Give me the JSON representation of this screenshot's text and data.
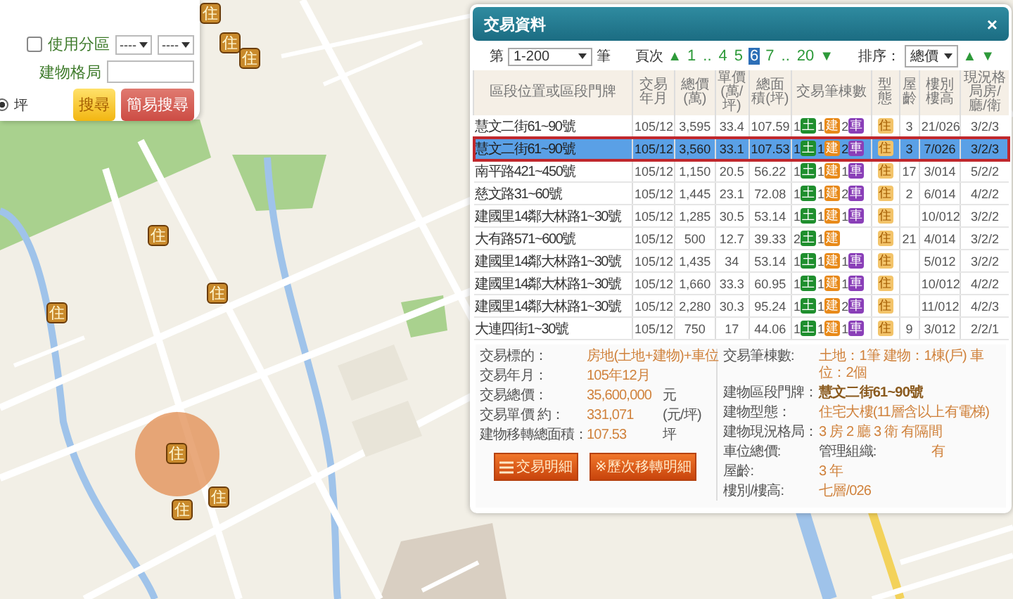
{
  "search_panel": {
    "zone_checkbox": {
      "label": "使用分區",
      "checked": false
    },
    "zone_selects": [
      "----",
      "----"
    ],
    "layout_label": "建物格局",
    "unit_radio": {
      "label": "坪",
      "selected": true
    },
    "buttons": [
      "搜尋",
      "簡易搜尋"
    ]
  },
  "map_markers": [
    {
      "label": "住",
      "selected": false
    },
    {
      "label": "住",
      "selected": false
    },
    {
      "label": "住",
      "selected": false
    },
    {
      "label": "住",
      "selected": false
    },
    {
      "label": "住",
      "selected": false
    },
    {
      "label": "住",
      "selected": false
    },
    {
      "label": "住",
      "selected": true
    },
    {
      "label": "住",
      "selected": false
    },
    {
      "label": "住",
      "selected": false
    }
  ],
  "dialog": {
    "title": "交易資料",
    "close": "×",
    "range": {
      "prefix": "第",
      "value": "1-200",
      "suffix": "筆"
    },
    "pager": {
      "label": "頁次",
      "prev": "▲",
      "next": "▼",
      "pages": [
        {
          "label": "1",
          "selected": false
        },
        {
          "label": "..",
          "selected": false
        },
        {
          "label": "4",
          "selected": false
        },
        {
          "label": "5",
          "selected": false
        },
        {
          "label": "6",
          "selected": true
        },
        {
          "label": "7",
          "selected": false
        },
        {
          "label": "..",
          "selected": false
        },
        {
          "label": "20",
          "selected": false
        }
      ]
    },
    "sort": {
      "label": "排序：",
      "value": "總價",
      "asc": "▲",
      "desc": "▼"
    },
    "table": {
      "columns": [
        "區段位置或區段門牌",
        "交易年月",
        "總價(萬)",
        "單價(萬/坪)",
        "總面積(坪)",
        "交易筆棟數",
        "型態",
        "屋齡",
        "樓別樓高",
        "現況格局房/廳/衛"
      ],
      "rows": [
        {
          "address": "慧文二街61~90號",
          "date": "105/12",
          "total": "3,595",
          "unit": "33.4",
          "area": "107.59",
          "tags": [
            {
              "kind": "land",
              "count": "1",
              "label": "土"
            },
            {
              "kind": "building",
              "count": "1",
              "label": "建"
            },
            {
              "kind": "parking",
              "count": "2",
              "label": "車"
            }
          ],
          "type": "住",
          "age": "3",
          "floor": "21/026",
          "layout": "3/2/3",
          "selected": false
        },
        {
          "address": "慧文二街61~90號",
          "date": "105/12",
          "total": "3,560",
          "unit": "33.1",
          "area": "107.53",
          "tags": [
            {
              "kind": "land",
              "count": "1",
              "label": "土"
            },
            {
              "kind": "building",
              "count": "1",
              "label": "建"
            },
            {
              "kind": "parking",
              "count": "2",
              "label": "車"
            }
          ],
          "type": "住",
          "age": "3",
          "floor": "7/026",
          "layout": "3/2/3",
          "selected": true
        },
        {
          "address": "南平路421~450號",
          "date": "105/12",
          "total": "1,150",
          "unit": "20.5",
          "area": "56.22",
          "tags": [
            {
              "kind": "land",
              "count": "1",
              "label": "土"
            },
            {
              "kind": "building",
              "count": "1",
              "label": "建"
            },
            {
              "kind": "parking",
              "count": "1",
              "label": "車"
            }
          ],
          "type": "住",
          "age": "17",
          "floor": "3/014",
          "layout": "5/2/2",
          "selected": false
        },
        {
          "address": "慈文路31~60號",
          "date": "105/12",
          "total": "1,445",
          "unit": "23.1",
          "area": "72.08",
          "tags": [
            {
              "kind": "land",
              "count": "1",
              "label": "土"
            },
            {
              "kind": "building",
              "count": "1",
              "label": "建"
            },
            {
              "kind": "parking",
              "count": "2",
              "label": "車"
            }
          ],
          "type": "住",
          "age": "2",
          "floor": "6/014",
          "layout": "4/2/2",
          "selected": false
        },
        {
          "address": "建國里14鄰大林路1~30號",
          "date": "105/12",
          "total": "1,285",
          "unit": "30.5",
          "area": "53.14",
          "tags": [
            {
              "kind": "land",
              "count": "1",
              "label": "土"
            },
            {
              "kind": "building",
              "count": "1",
              "label": "建"
            },
            {
              "kind": "parking",
              "count": "1",
              "label": "車"
            }
          ],
          "type": "住",
          "floor": "10/012",
          "layout": "3/2/2",
          "selected": false
        },
        {
          "address": "大有路571~600號",
          "date": "105/12",
          "total": "500",
          "unit": "12.7",
          "area": "39.33",
          "tags": [
            {
              "kind": "land",
              "count": "2",
              "label": "土"
            },
            {
              "kind": "building",
              "count": "1",
              "label": "建"
            }
          ],
          "type": "住",
          "age": "21",
          "floor": "4/014",
          "layout": "3/2/2",
          "selected": false
        },
        {
          "address": "建國里14鄰大林路1~30號",
          "date": "105/12",
          "total": "1,435",
          "unit": "34",
          "area": "53.14",
          "tags": [
            {
              "kind": "land",
              "count": "1",
              "label": "土"
            },
            {
              "kind": "building",
              "count": "1",
              "label": "建"
            },
            {
              "kind": "parking",
              "count": "1",
              "label": "車"
            }
          ],
          "type": "住",
          "floor": "5/012",
          "layout": "3/2/2",
          "selected": false
        },
        {
          "address": "建國里14鄰大林路1~30號",
          "date": "105/12",
          "total": "1,660",
          "unit": "33.3",
          "area": "60.95",
          "tags": [
            {
              "kind": "land",
              "count": "1",
              "label": "土"
            },
            {
              "kind": "building",
              "count": "1",
              "label": "建"
            },
            {
              "kind": "parking",
              "count": "1",
              "label": "車"
            }
          ],
          "type": "住",
          "floor": "10/012",
          "layout": "4/2/2",
          "selected": false
        },
        {
          "address": "建國里14鄰大林路1~30號",
          "date": "105/12",
          "total": "2,280",
          "unit": "30.3",
          "area": "95.24",
          "tags": [
            {
              "kind": "land",
              "count": "1",
              "label": "土"
            },
            {
              "kind": "building",
              "count": "1",
              "label": "建"
            },
            {
              "kind": "parking",
              "count": "2",
              "label": "車"
            }
          ],
          "type": "住",
          "floor": "11/012",
          "layout": "4/2/3",
          "selected": false
        },
        {
          "address": "大連四街1~30號",
          "date": "105/12",
          "total": "750",
          "unit": "17",
          "area": "44.06",
          "tags": [
            {
              "kind": "land",
              "count": "1",
              "label": "土"
            },
            {
              "kind": "building",
              "count": "1",
              "label": "建"
            },
            {
              "kind": "parking",
              "count": "1",
              "label": "車"
            }
          ],
          "type": "住",
          "age": "9",
          "floor": "3/012",
          "layout": "2/2/1",
          "selected": false
        }
      ]
    },
    "details": {
      "left": [
        {
          "label": "交易標的：",
          "value": "房地(土地+建物)+車位"
        },
        {
          "label": "交易年月：",
          "value": "105年12月"
        },
        {
          "label": "交易總價：",
          "value": "35,600,000",
          "unit": "元"
        },
        {
          "label": "交易單價 約：",
          "value": "331,071",
          "unit": "(元/坪)"
        },
        {
          "label": "建物移轉總面積：",
          "value": "107.53",
          "unit": "坪"
        }
      ],
      "buttons": [
        {
          "kind": "list",
          "label": "交易明細"
        },
        {
          "kind": "plain",
          "label": "※歷次移轉明細"
        }
      ],
      "right": [
        {
          "label": "交易筆棟數:",
          "value": "土地：1筆 建物：1棟(戶) 車位：2個"
        },
        {
          "label": "建物區段門牌：",
          "value": "慧文二街61~90號",
          "emphasis": true
        },
        {
          "label": "建物型態：",
          "value": "住宅大樓(11層含以上有電梯)"
        },
        {
          "label": "建物現況格局：",
          "value": "3 房 2 廳 3 衛 有隔間"
        },
        {
          "label": "車位總價:",
          "extra_label": "管理組織:",
          "extra_value": "有"
        },
        {
          "label": "屋齡:",
          "value": "3 年"
        },
        {
          "label": "樓別/樓高:",
          "value": "七層/026"
        }
      ]
    }
  }
}
